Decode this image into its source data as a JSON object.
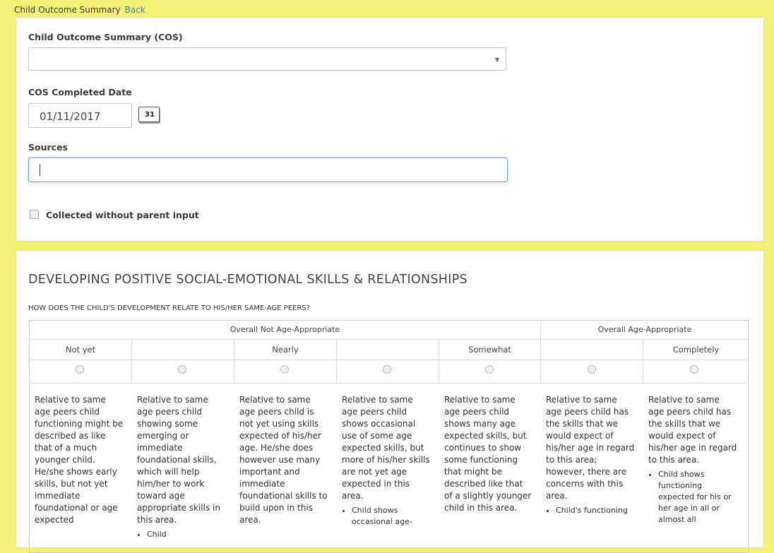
{
  "header": {
    "title": "Child Outcome Summary",
    "back_label": "Back"
  },
  "form": {
    "cos_label": "Child Outcome Summary (COS)",
    "cos_value": "",
    "date_label": "COS Completed Date",
    "date_value": "01/11/2017",
    "calendar_day": "31",
    "sources_label": "Sources",
    "sources_value": "",
    "checkbox_label": "Collected without parent input"
  },
  "section": {
    "title": "DEVELOPING POSITIVE SOCIAL-EMOTIONAL SKILLS & RELATIONSHIPS",
    "question": "HOW DOES THE CHILD'S DEVELOPMENT RELATE TO HIS/HER SAME-AGE PEERS?",
    "groups": [
      "Overall Not Age-Appropriate",
      "Overall Age-Appropriate"
    ],
    "ratings": [
      "Not yet",
      "",
      "Nearly",
      "",
      "Somewhat",
      "",
      "Completely"
    ],
    "descriptions": [
      {
        "text": "Relative to same age peers child functioning might be described as like that of a much younger child. He/she shows early skills, but not yet immediate foundational or age expected",
        "bullet": ""
      },
      {
        "text": "Relative to same age peers child showing some emerging or immediate foundational skills, which will help him/her to work toward age appropriate skills in this area.",
        "bullet": "Child"
      },
      {
        "text": "Relative to same age peers child is not yet using skills expected of his/her age. He/she does however use many important and immediate foundational skills to build upon in this area.",
        "bullet": ""
      },
      {
        "text": "Relative to same age peers child shows occasional use of some age expected skills, but more of his/her skills are not yet age expected in this area.",
        "bullet": "Child shows occasional age-"
      },
      {
        "text": "Relative to same age peers child shows many age expected skills, but continues to show some functioning that might be described like that of a slightly younger child in this area.",
        "bullet": ""
      },
      {
        "text": "Relative to same age peers child has the skills that we would expect of his/her age in regard to this area; however, there are concerns with this area.",
        "bullet": "Child's functioning"
      },
      {
        "text": "Relative to same age peers child has the skills that we would expect of his/her age in regard to this area.",
        "bullet": "Child shows functioning expected for his or her age in all or almost all"
      }
    ]
  }
}
